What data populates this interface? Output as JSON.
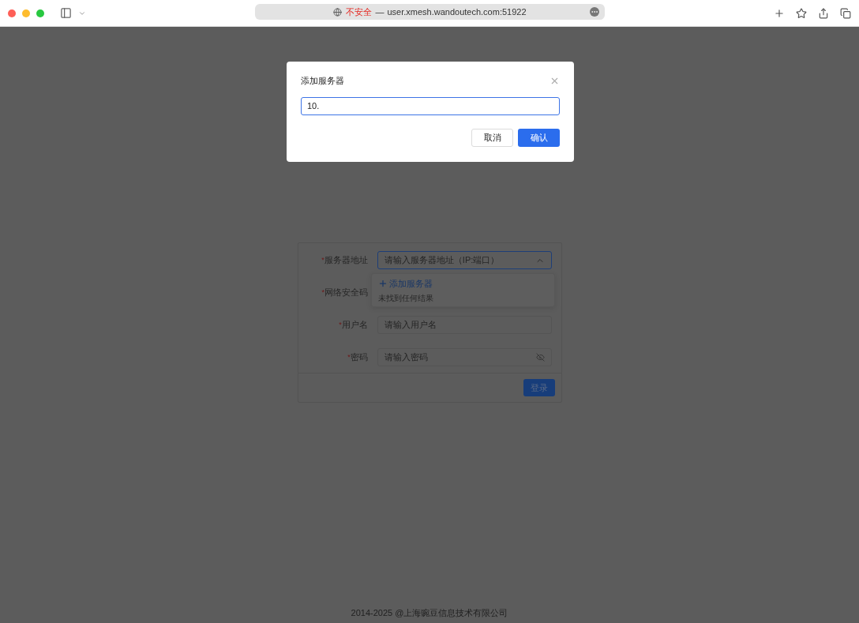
{
  "browser": {
    "security_warning": "不安全",
    "separator": "—",
    "url": "user.xmesh.wandoutech.com:51922"
  },
  "form": {
    "fields": [
      {
        "kind": "select",
        "required_mark": "*",
        "label": "服务器地址",
        "placeholder": "请输入服务器地址（IP:端口）",
        "expanded": true
      },
      {
        "kind": "covered",
        "required_mark": "*",
        "label": "网络安全码"
      },
      {
        "kind": "text",
        "required_mark": "*",
        "label": "用户名",
        "placeholder": "请输入用户名"
      },
      {
        "kind": "password",
        "required_mark": "*",
        "label": "密码",
        "placeholder": "请输入密码"
      }
    ],
    "dropdown": {
      "action": "添加服务器",
      "empty_text": "未找到任何结果"
    },
    "submit": "登录"
  },
  "modal": {
    "title": "添加服务器",
    "value": "10.",
    "buttons": [
      {
        "kind": "cancel",
        "label": "取消"
      },
      {
        "kind": "confirm",
        "label": "确认"
      }
    ]
  },
  "footer": "2014-2025 @上海豌豆信息技术有限公司"
}
